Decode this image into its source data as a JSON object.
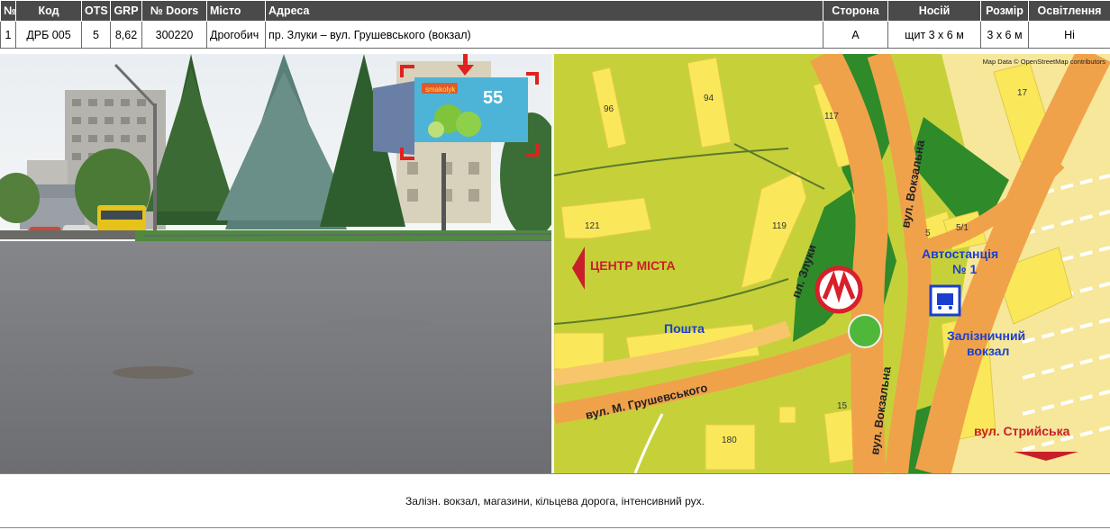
{
  "table": {
    "headers": [
      "№",
      "Код",
      "OTS",
      "GRP",
      "№ Doors",
      "Місто",
      "Адреса",
      "Сторона",
      "Носій",
      "Розмір",
      "Освітлення"
    ],
    "row": [
      "1",
      "ДРБ 005",
      "5",
      "8,62",
      "300220",
      "Дрогобич",
      "пр. Злуки – вул. Грушевського (вокзал)",
      "А",
      "щит 3 х 6 м",
      "3 х 6 м",
      "Ні"
    ]
  },
  "photo": {
    "billboard_price": "55",
    "billboard_tag": "smakolyk"
  },
  "map": {
    "attribution": "Map Data © OpenStreetMap contributors",
    "house_numbers": [
      "96",
      "94",
      "117",
      "17",
      "121",
      "119",
      "5",
      "5/1",
      "15",
      "180"
    ],
    "labels": {
      "center": "ЦЕНТР МІСТА",
      "post": "Пошта",
      "bus_station_line1": "Автостанція",
      "bus_station_line2": "№ 1",
      "rail_line1": "Залізничний",
      "rail_line2": "вокзал",
      "street_stryiska": "вул. Стрийська",
      "street_hrushevskoho": "вул. М. Грушевського",
      "street_zluky": "пл. Злуки",
      "street_vokzalna_top": "вул. Вокзальна",
      "street_vokzalna_bottom": "вул. Вокзальна"
    },
    "colors": {
      "road": "#f0a24a",
      "block": "#c6d13a",
      "building": "#fbe85a",
      "park": "#2f8a2a",
      "arrow": "#c8202a",
      "label_blue": "#1a3fcf"
    }
  },
  "description": "Залізн. вокзал, магазини, кільцева дорога, інтенсивний рух."
}
